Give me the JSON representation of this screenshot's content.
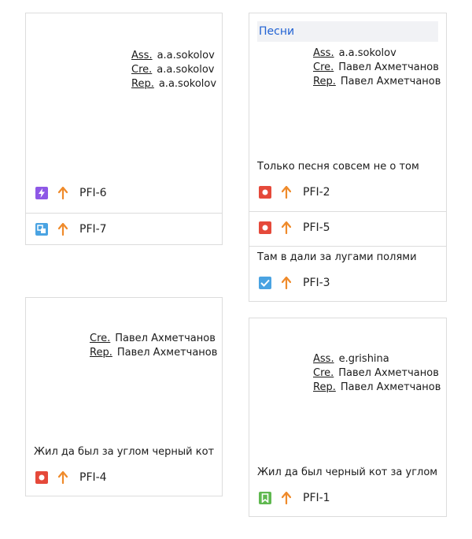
{
  "colors": {
    "purple": "#8e58e6",
    "blue": "#4aa3e2",
    "red": "#e5493a",
    "check_blue": "#4aa3e2",
    "green": "#5fb84f",
    "priority_orange": "#ef8a2a",
    "title_blue": "#2162d3"
  },
  "labels": {
    "ass": "Ass.",
    "cre": "Cre.",
    "rep": "Rep."
  },
  "cards": {
    "c1": {
      "ass": "a.a.sokolov",
      "cre": "a.a.sokolov",
      "rep": "a.a.sokolov",
      "issues": [
        {
          "key": "PFI-6",
          "icon": "bolt-icon",
          "priority": "arrow-up-icon"
        },
        {
          "key": "PFI-7",
          "icon": "subtask-icon",
          "priority": "arrow-up-icon"
        }
      ]
    },
    "c2": {
      "title": "Песни",
      "ass": "a.a.sokolov",
      "cre": "Павел Ахметчанов",
      "rep": "Павел Ахметчанов",
      "description": "Только песня совсем не о том",
      "issues": [
        {
          "key": "PFI-2",
          "icon": "bug-icon",
          "priority": "arrow-up-icon"
        },
        {
          "key": "PFI-5",
          "icon": "bug-icon",
          "priority": "arrow-up-icon"
        }
      ],
      "note": "Там в дали за лугами полями",
      "extra_issue": {
        "key": "PFI-3",
        "icon": "checkbox-icon",
        "priority": "arrow-up-icon"
      }
    },
    "c3": {
      "cre": "Павел Ахметчанов",
      "rep": "Павел Ахметчанов",
      "description": "Жил да был за углом черный кот",
      "issues": [
        {
          "key": "PFI-4",
          "icon": "bug-icon",
          "priority": "arrow-up-icon"
        }
      ]
    },
    "c4": {
      "ass": "e.grishina",
      "cre": "Павел Ахметчанов",
      "rep": "Павел Ахметчанов",
      "description": "Жил да был черный кот за углом",
      "issues": [
        {
          "key": "PFI-1",
          "icon": "bookmark-icon",
          "priority": "arrow-up-icon"
        }
      ]
    }
  }
}
